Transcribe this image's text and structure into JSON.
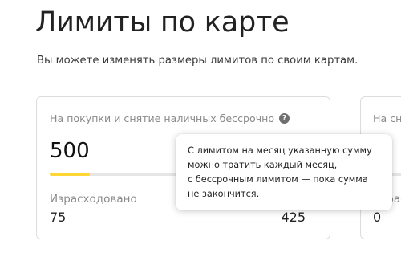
{
  "header": {
    "title": "Лимиты по карте",
    "subtitle": "Вы можете изменять размеры лимитов по своим картам."
  },
  "cards": [
    {
      "label": "На покупки и снятие наличных бессрочно",
      "limit": "500",
      "spent_label": "Израсходовано",
      "spent": "75",
      "remaining": "425",
      "progress_fraction": 0.15,
      "help_icon": "question-mark-icon"
    },
    {
      "label": "На сн",
      "spent_label": "Израс",
      "spent": "0"
    }
  ],
  "tooltip": {
    "lines": [
      "С лимитом на месяц указанную сумму",
      "можно тратить каждый месяц,",
      "с бессрочным лимитом — пока сумма",
      "не закончится."
    ]
  },
  "colors": {
    "progress_fill": "#ffd633",
    "progress_track": "#e6e6e6",
    "card_border": "#dcdcdc",
    "muted_text": "#8a8a8a"
  }
}
